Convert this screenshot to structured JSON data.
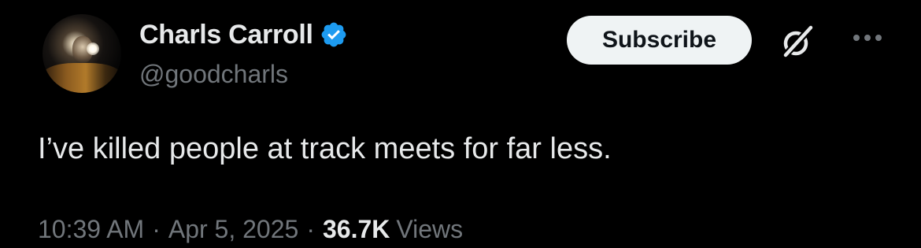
{
  "author": {
    "display_name": "Charls Carroll",
    "handle": "@goodcharls",
    "verified": true,
    "verified_color": "#1d9bf0",
    "avatar_icon": "avatar-photo"
  },
  "header_actions": {
    "subscribe_label": "Subscribe",
    "grok_icon": "grok-icon",
    "more_icon": "more-icon"
  },
  "tweet": {
    "text": "I’ve killed people at track meets for far less."
  },
  "meta": {
    "time": "10:39 AM",
    "separator": "·",
    "date": "Apr 5, 2025",
    "views_count": "36.7K",
    "views_label": "Views"
  },
  "colors": {
    "background": "#000000",
    "primary_text": "#e7e9ea",
    "secondary_text": "#71767b",
    "button_bg": "#eff3f4"
  }
}
